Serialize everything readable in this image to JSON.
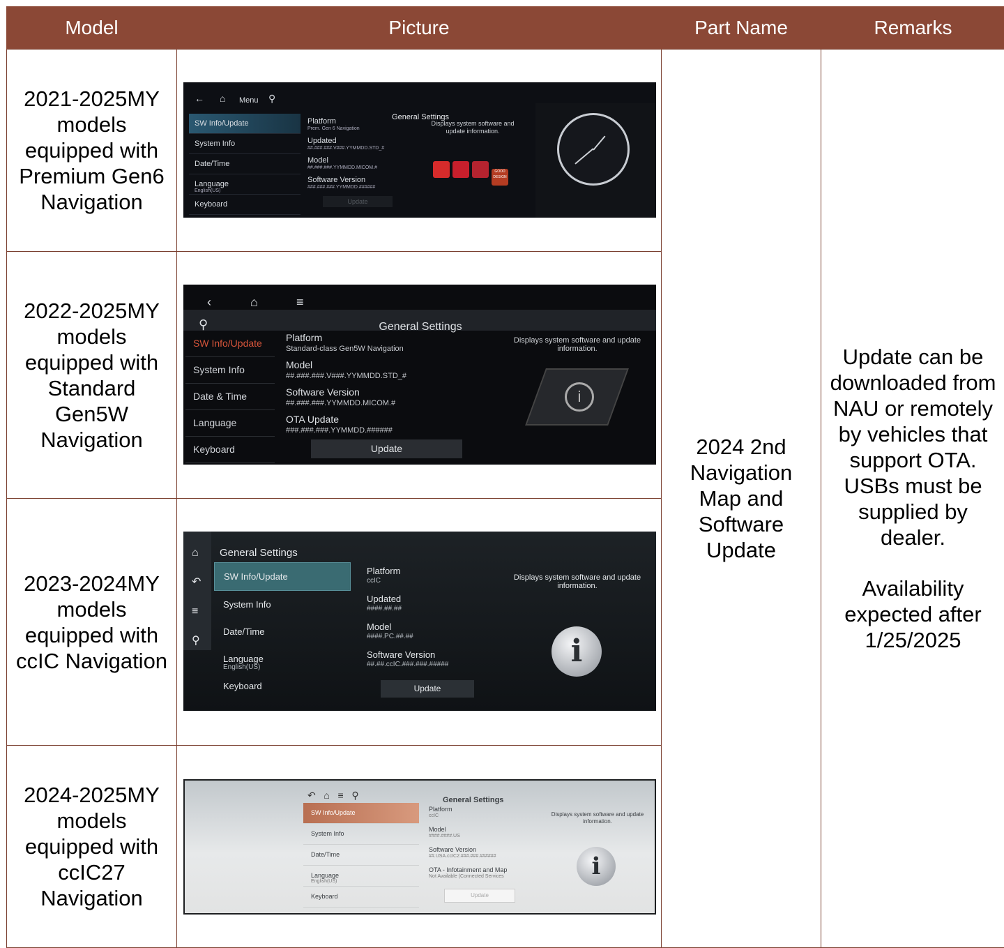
{
  "headers": {
    "model": "Model",
    "picture": "Picture",
    "part_name": "Part Name",
    "remarks": "Remarks"
  },
  "part_name": "2024 2nd Navigation Map and Software Update",
  "remarks": {
    "p1": "Update can be downloaded from NAU or remotely by vehicles that support OTA. USBs must be supplied by dealer.",
    "p2": "Availability expected after 1/25/2025"
  },
  "rows": [
    {
      "model": "2021-2025MY models equipped with Premium Gen6 Navigation"
    },
    {
      "model": "2022-2025MY models equipped with Standard Gen5W Navigation"
    },
    {
      "model": "2023-2024MY models equipped with ccIC Navigation"
    },
    {
      "model": "2024-2025MY models equipped with ccIC27 Navigation"
    }
  ],
  "screens": {
    "s1": {
      "menu_label": "Menu",
      "title": "General Settings",
      "menu": [
        "SW Info/Update",
        "System Info",
        "Date/Time",
        "Language",
        "Keyboard"
      ],
      "language_sub": "English(US)",
      "details": [
        {
          "label": "Platform",
          "value": "Prem. Gen 6 Navigation"
        },
        {
          "label": "Updated",
          "value": "##.###.###.V###.YYMMDD.STD_#"
        },
        {
          "label": "Model",
          "value": "##.###.###.YYMMDD.MICOM.#"
        },
        {
          "label": "Software Version",
          "value": "###.###.###.YYMMDD.######"
        }
      ],
      "description": "Displays system software and update information.",
      "update": "Update",
      "badge_text": "GOOD DESIGN"
    },
    "s2": {
      "title": "General Settings",
      "menu": [
        "SW Info/Update",
        "System Info",
        "Date & Time",
        "Language",
        "Keyboard"
      ],
      "details": [
        {
          "label": "Platform",
          "value": "Standard-class Gen5W Navigation"
        },
        {
          "label": "Model",
          "value": "##.###.###.V###.YYMMDD.STD_#"
        },
        {
          "label": "Software Version",
          "value": "##.###.###.YYMMDD.MICOM.#"
        },
        {
          "label": "OTA Update",
          "value": "###.###.###.YYMMDD.######"
        }
      ],
      "description": "Displays system software and update information.",
      "update": "Update"
    },
    "s3": {
      "title": "General Settings",
      "menu": [
        "SW Info/Update",
        "System Info",
        "Date/Time",
        "Language",
        "Keyboard"
      ],
      "language_sub": "English(US)",
      "details": [
        {
          "label": "Platform",
          "value": "ccIC"
        },
        {
          "label": "Updated",
          "value": "####.##.##"
        },
        {
          "label": "Model",
          "value": "####.PC.##.##"
        },
        {
          "label": "Software Version",
          "value": "##.##.ccIC.###.###.#####"
        }
      ],
      "description": "Displays system software and update information.",
      "update": "Update"
    },
    "s4": {
      "title": "General Settings",
      "menu": [
        "SW Info/Update",
        "System Info",
        "Date/Time",
        "Language",
        "Keyboard"
      ],
      "language_sub": "English(US)",
      "details": [
        {
          "label": "Platform",
          "value": "ccIC"
        },
        {
          "label": "Model",
          "value": "####.####.US"
        },
        {
          "label": "Software Version",
          "value": "##.USA.ccIC2.###.###.######"
        },
        {
          "label": "OTA - Infotainment and Map",
          "value": "Not Available (Connected Services"
        }
      ],
      "description": "Displays system software and update information.",
      "update": "Update"
    }
  },
  "colors": {
    "header_bg": "#8b4836",
    "s2_selected": "#d5543a",
    "s4_selected": "#b86f52"
  }
}
